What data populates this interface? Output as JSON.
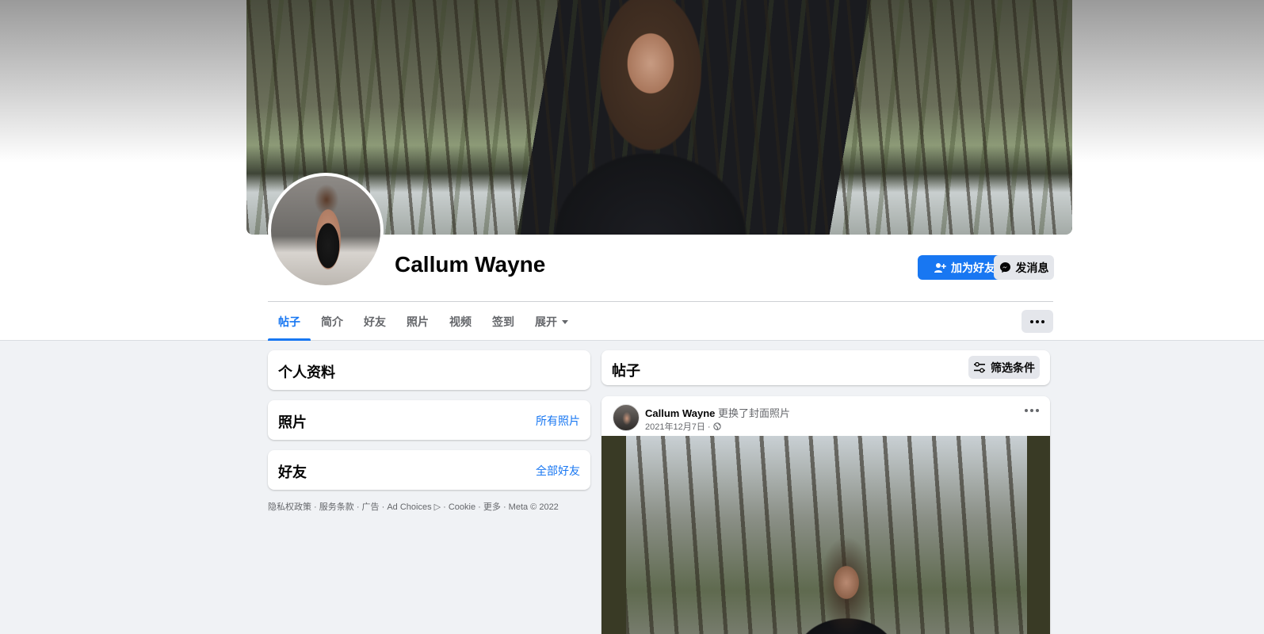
{
  "profile": {
    "name": "Callum Wayne",
    "add_friend_label": "加为好友",
    "message_label": "发消息"
  },
  "tabs": [
    {
      "label": "帖子",
      "active": true
    },
    {
      "label": "简介",
      "active": false
    },
    {
      "label": "好友",
      "active": false
    },
    {
      "label": "照片",
      "active": false
    },
    {
      "label": "视频",
      "active": false
    },
    {
      "label": "签到",
      "active": false
    },
    {
      "label": "展开",
      "active": false
    }
  ],
  "sidebar": {
    "intro_title": "个人资料",
    "photos_title": "照片",
    "photos_link": "所有照片",
    "friends_title": "好友",
    "friends_link": "全部好友",
    "footer": "隐私权政策 · 服务条款 · 广告 · Ad Choices ▷ · Cookie · 更多 · Meta © 2022"
  },
  "posts": {
    "title": "帖子",
    "filter_label": "筛选条件",
    "items": [
      {
        "author": "Callum Wayne",
        "action": "更换了封面照片",
        "date": "2021年12月7日 · "
      }
    ]
  },
  "colors": {
    "accent": "#1877f2",
    "background": "#f0f2f5",
    "button_gray": "#e4e6eb"
  },
  "icons": {
    "add_friend": "person-plus-icon",
    "message": "messenger-icon",
    "more": "more-dots-icon",
    "filter": "sliders-icon",
    "privacy": "globe-icon",
    "dropdown": "caret-down-icon"
  }
}
